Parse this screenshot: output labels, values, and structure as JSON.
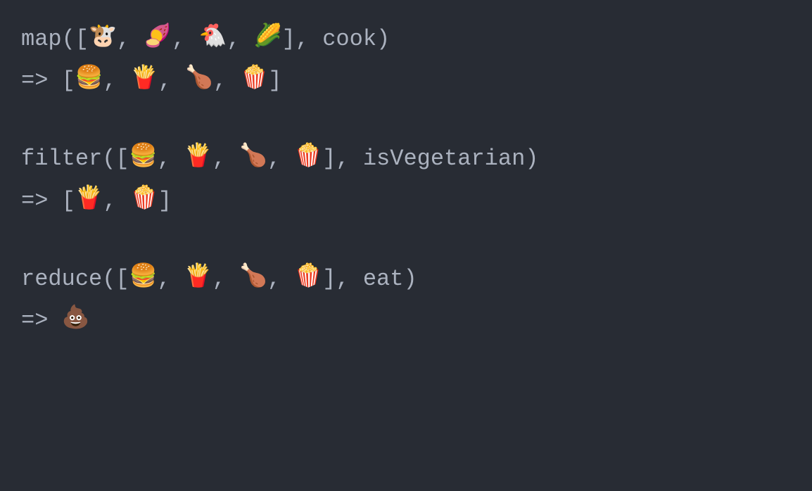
{
  "examples": [
    {
      "func": "map",
      "open": "([",
      "items": [
        "🐮",
        "🍠",
        "🐔",
        "🌽"
      ],
      "sep": ", ",
      "close_args": "], ",
      "callback": "cook",
      "close": ")",
      "arrow": "=> ",
      "result_open": "[",
      "result_items": [
        "🍔",
        "🍟",
        "🍗",
        "🍿"
      ],
      "result_close": "]"
    },
    {
      "func": "filter",
      "open": "([",
      "items": [
        "🍔",
        "🍟",
        "🍗",
        "🍿"
      ],
      "sep": ", ",
      "close_args": "], ",
      "callback": "isVegetarian",
      "close": ")",
      "arrow": "=> ",
      "result_open": "[",
      "result_items": [
        "🍟",
        "🍿"
      ],
      "result_close": "]"
    },
    {
      "func": "reduce",
      "open": "([",
      "items": [
        "🍔",
        "🍟",
        "🍗",
        "🍿"
      ],
      "sep": ", ",
      "close_args": "], ",
      "callback": "eat",
      "close": ")",
      "arrow": "=> ",
      "result_open": "",
      "result_items": [
        "💩"
      ],
      "result_close": ""
    }
  ]
}
